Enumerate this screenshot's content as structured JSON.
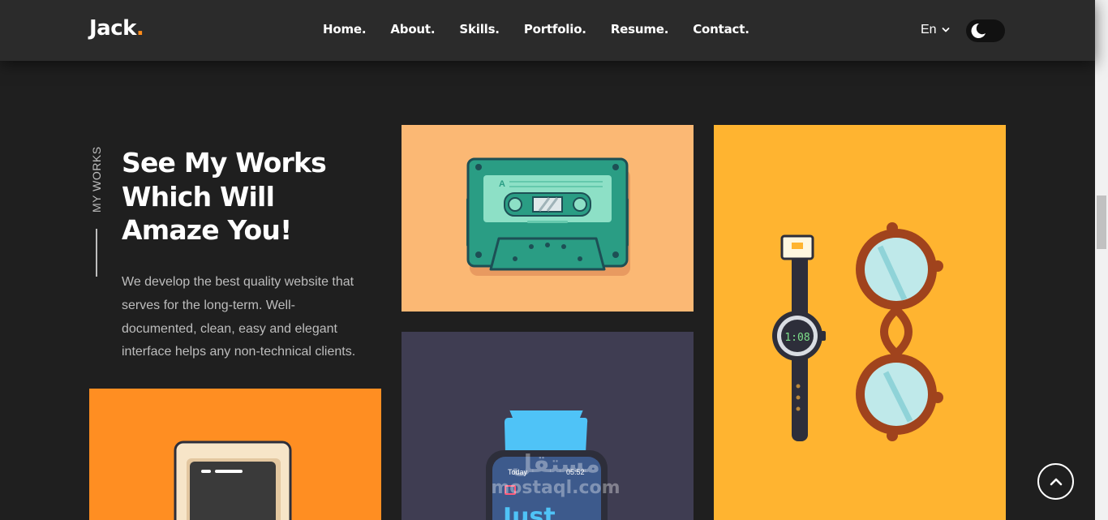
{
  "header": {
    "logo": "Jack",
    "logo_dot": ".",
    "nav": [
      "Home.",
      "About.",
      "Skills.",
      "Portfolio.",
      "Resume.",
      "Contact."
    ],
    "lang": "En",
    "theme_icon": "moon-icon"
  },
  "section": {
    "vertical_label": "MY WORKS",
    "heading": "See My Works Which Will Amaze You!",
    "description": "We develop the best quality website that serves for the long-term. Well-documented, clean, easy and elegant interface helps any non-technical clients."
  },
  "portfolio": {
    "cassette_label": "A",
    "watch_time": "1:08",
    "smartwatch_day": "Today",
    "smartwatch_time": "05:52",
    "smartwatch_word": "Just"
  },
  "watermark": {
    "arabic": "مستقل",
    "english": "mostaql.com"
  },
  "colors": {
    "accent": "#ff8c1a",
    "background": "#1f1f1f",
    "header": "#2b2b2b",
    "card_cassette": "#fbb874",
    "card_watch": "#ffb430",
    "card_phone": "#ff8e22",
    "card_smartwatch": "#3f3d52"
  },
  "icons": {
    "lang_dropdown": "chevron-down-icon",
    "back_to_top": "chevron-up-icon"
  }
}
